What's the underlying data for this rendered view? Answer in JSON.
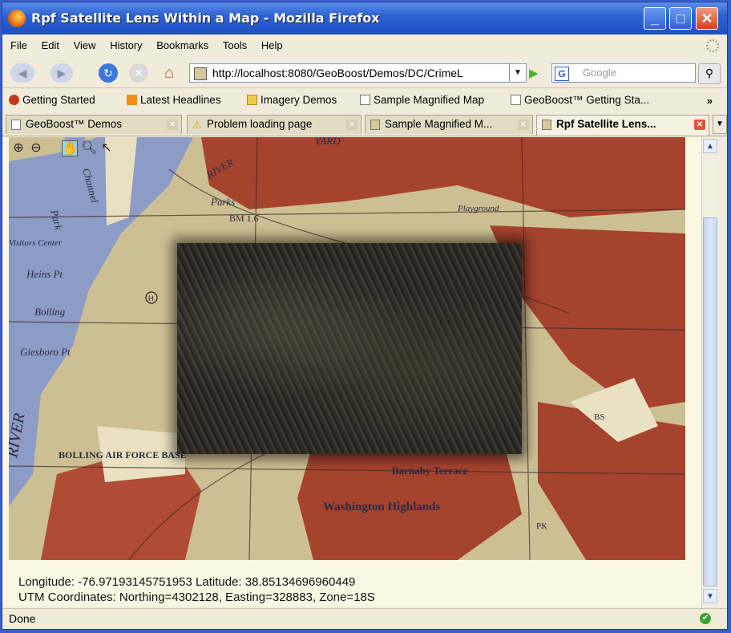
{
  "window": {
    "title": "Rpf Satellite Lens Within a Map - Mozilla Firefox",
    "min": "_",
    "max": "□",
    "close": "✕"
  },
  "menu": [
    "File",
    "Edit",
    "View",
    "History",
    "Bookmarks",
    "Tools",
    "Help"
  ],
  "nav": {
    "url": "http://localhost:8080/GeoBoost/Demos/DC/CrimeL",
    "search_placeholder": "Google",
    "search_engine": "G"
  },
  "bookmarks": [
    "Getting Started",
    "Latest Headlines",
    "Imagery Demos",
    "Sample Magnified Map",
    "GeoBoost™ Getting Sta..."
  ],
  "bookmarks_more": "»",
  "tabs": [
    {
      "label": "GeoBoost™ Demos",
      "active": false
    },
    {
      "label": "Problem loading page",
      "active": false
    },
    {
      "label": "Sample Magnified M...",
      "active": false
    },
    {
      "label": "Rpf Satellite Lens...",
      "active": true
    }
  ],
  "map": {
    "labels": [
      "YARD",
      "Channel",
      "Park",
      "Parks",
      "RIVER",
      "Visitors Center",
      "Heins Pt",
      "Bolling",
      "Giesboro Pt",
      "RIVER",
      "BOLLING AIR FORCE BASE",
      "Barnaby Terrace",
      "Washington Highlands",
      "Playground",
      "BM 1.6",
      "BS",
      "PK"
    ]
  },
  "coords": {
    "line1": "Longitude: -76.97193145751953 Latitude: 38.85134696960449",
    "line2": "UTM Coordinates: Northing=4302128, Easting=328883, Zone=18S"
  },
  "status": {
    "text": "Done"
  },
  "colors": {
    "titlebar": "#2e63d3",
    "chrome": "#f0ebda",
    "map_urban": "#a8432f",
    "map_water": "#8e9ec8"
  }
}
